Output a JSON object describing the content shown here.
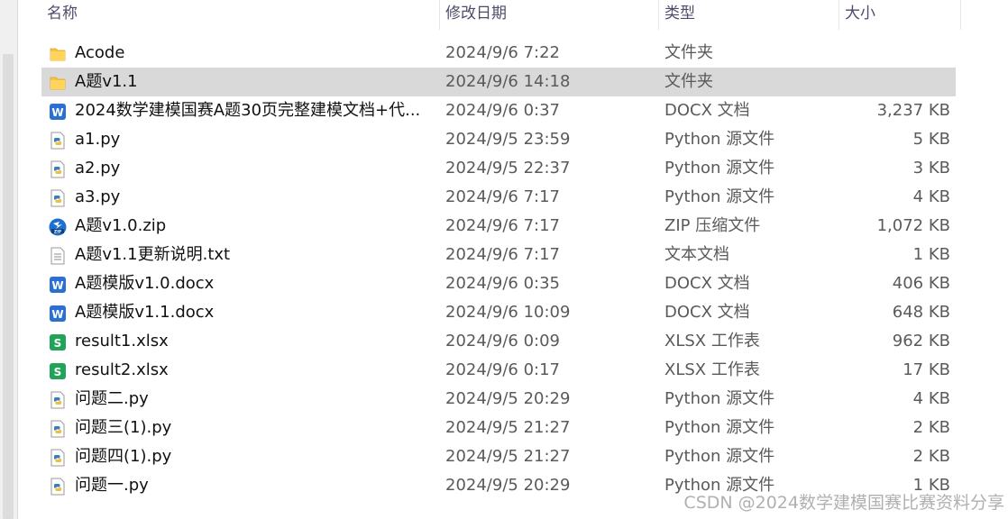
{
  "header": {
    "name": "名称",
    "date": "修改日期",
    "type": "类型",
    "size": "大小"
  },
  "files": [
    {
      "name": "Acode",
      "date": "2024/9/6 7:22",
      "type": "文件夹",
      "size": "",
      "icon": "folder-icon"
    },
    {
      "name": "A题v1.1",
      "date": "2024/9/6 14:18",
      "type": "文件夹",
      "size": "",
      "icon": "folder-icon"
    },
    {
      "name": "2024数学建模国赛A题30页完整建模文档+代...",
      "date": "2024/9/6 0:37",
      "type": "DOCX 文档",
      "size": "3,237 KB",
      "icon": "word-doc-icon"
    },
    {
      "name": "a1.py",
      "date": "2024/9/5 23:59",
      "type": "Python 源文件",
      "size": "5 KB",
      "icon": "python-file-icon"
    },
    {
      "name": "a2.py",
      "date": "2024/9/5 22:37",
      "type": "Python 源文件",
      "size": "3 KB",
      "icon": "python-file-icon"
    },
    {
      "name": "a3.py",
      "date": "2024/9/6 7:17",
      "type": "Python 源文件",
      "size": "4 KB",
      "icon": "python-file-icon"
    },
    {
      "name": "A题v1.0.zip",
      "date": "2024/9/6 7:17",
      "type": "ZIP 压缩文件",
      "size": "1,072 KB",
      "icon": "zip-archive-icon"
    },
    {
      "name": "A题v1.1更新说明.txt",
      "date": "2024/9/6 7:17",
      "type": "文本文档",
      "size": "1 KB",
      "icon": "text-file-icon"
    },
    {
      "name": "A题模版v1.0.docx",
      "date": "2024/9/6 0:35",
      "type": "DOCX 文档",
      "size": "406 KB",
      "icon": "word-doc-icon"
    },
    {
      "name": "A题模版v1.1.docx",
      "date": "2024/9/6 10:09",
      "type": "DOCX 文档",
      "size": "648 KB",
      "icon": "word-doc-icon"
    },
    {
      "name": "result1.xlsx",
      "date": "2024/9/6 0:09",
      "type": "XLSX 工作表",
      "size": "962 KB",
      "icon": "spreadsheet-icon"
    },
    {
      "name": "result2.xlsx",
      "date": "2024/9/6 0:17",
      "type": "XLSX 工作表",
      "size": "17 KB",
      "icon": "spreadsheet-icon"
    },
    {
      "name": "问题二.py",
      "date": "2024/9/5 20:29",
      "type": "Python 源文件",
      "size": "4 KB",
      "icon": "python-file-icon"
    },
    {
      "name": "问题三(1).py",
      "date": "2024/9/5 21:27",
      "type": "Python 源文件",
      "size": "2 KB",
      "icon": "python-file-icon"
    },
    {
      "name": "问题四(1).py",
      "date": "2024/9/5 21:27",
      "type": "Python 源文件",
      "size": "2 KB",
      "icon": "python-file-icon"
    },
    {
      "name": "问题一.py",
      "date": "2024/9/5 20:29",
      "type": "Python 源文件",
      "size": "1 KB",
      "icon": "python-file-icon"
    }
  ],
  "selected_file": "A题v1.1",
  "watermark": "CSDN @2024数学建模国赛比赛资料分享",
  "colors": {
    "selection": "#d9d9d9",
    "folder": "#f5c542",
    "word": "#2b6fd6",
    "spreadsheet": "#21a35a",
    "zip": "#1f6fd1"
  }
}
